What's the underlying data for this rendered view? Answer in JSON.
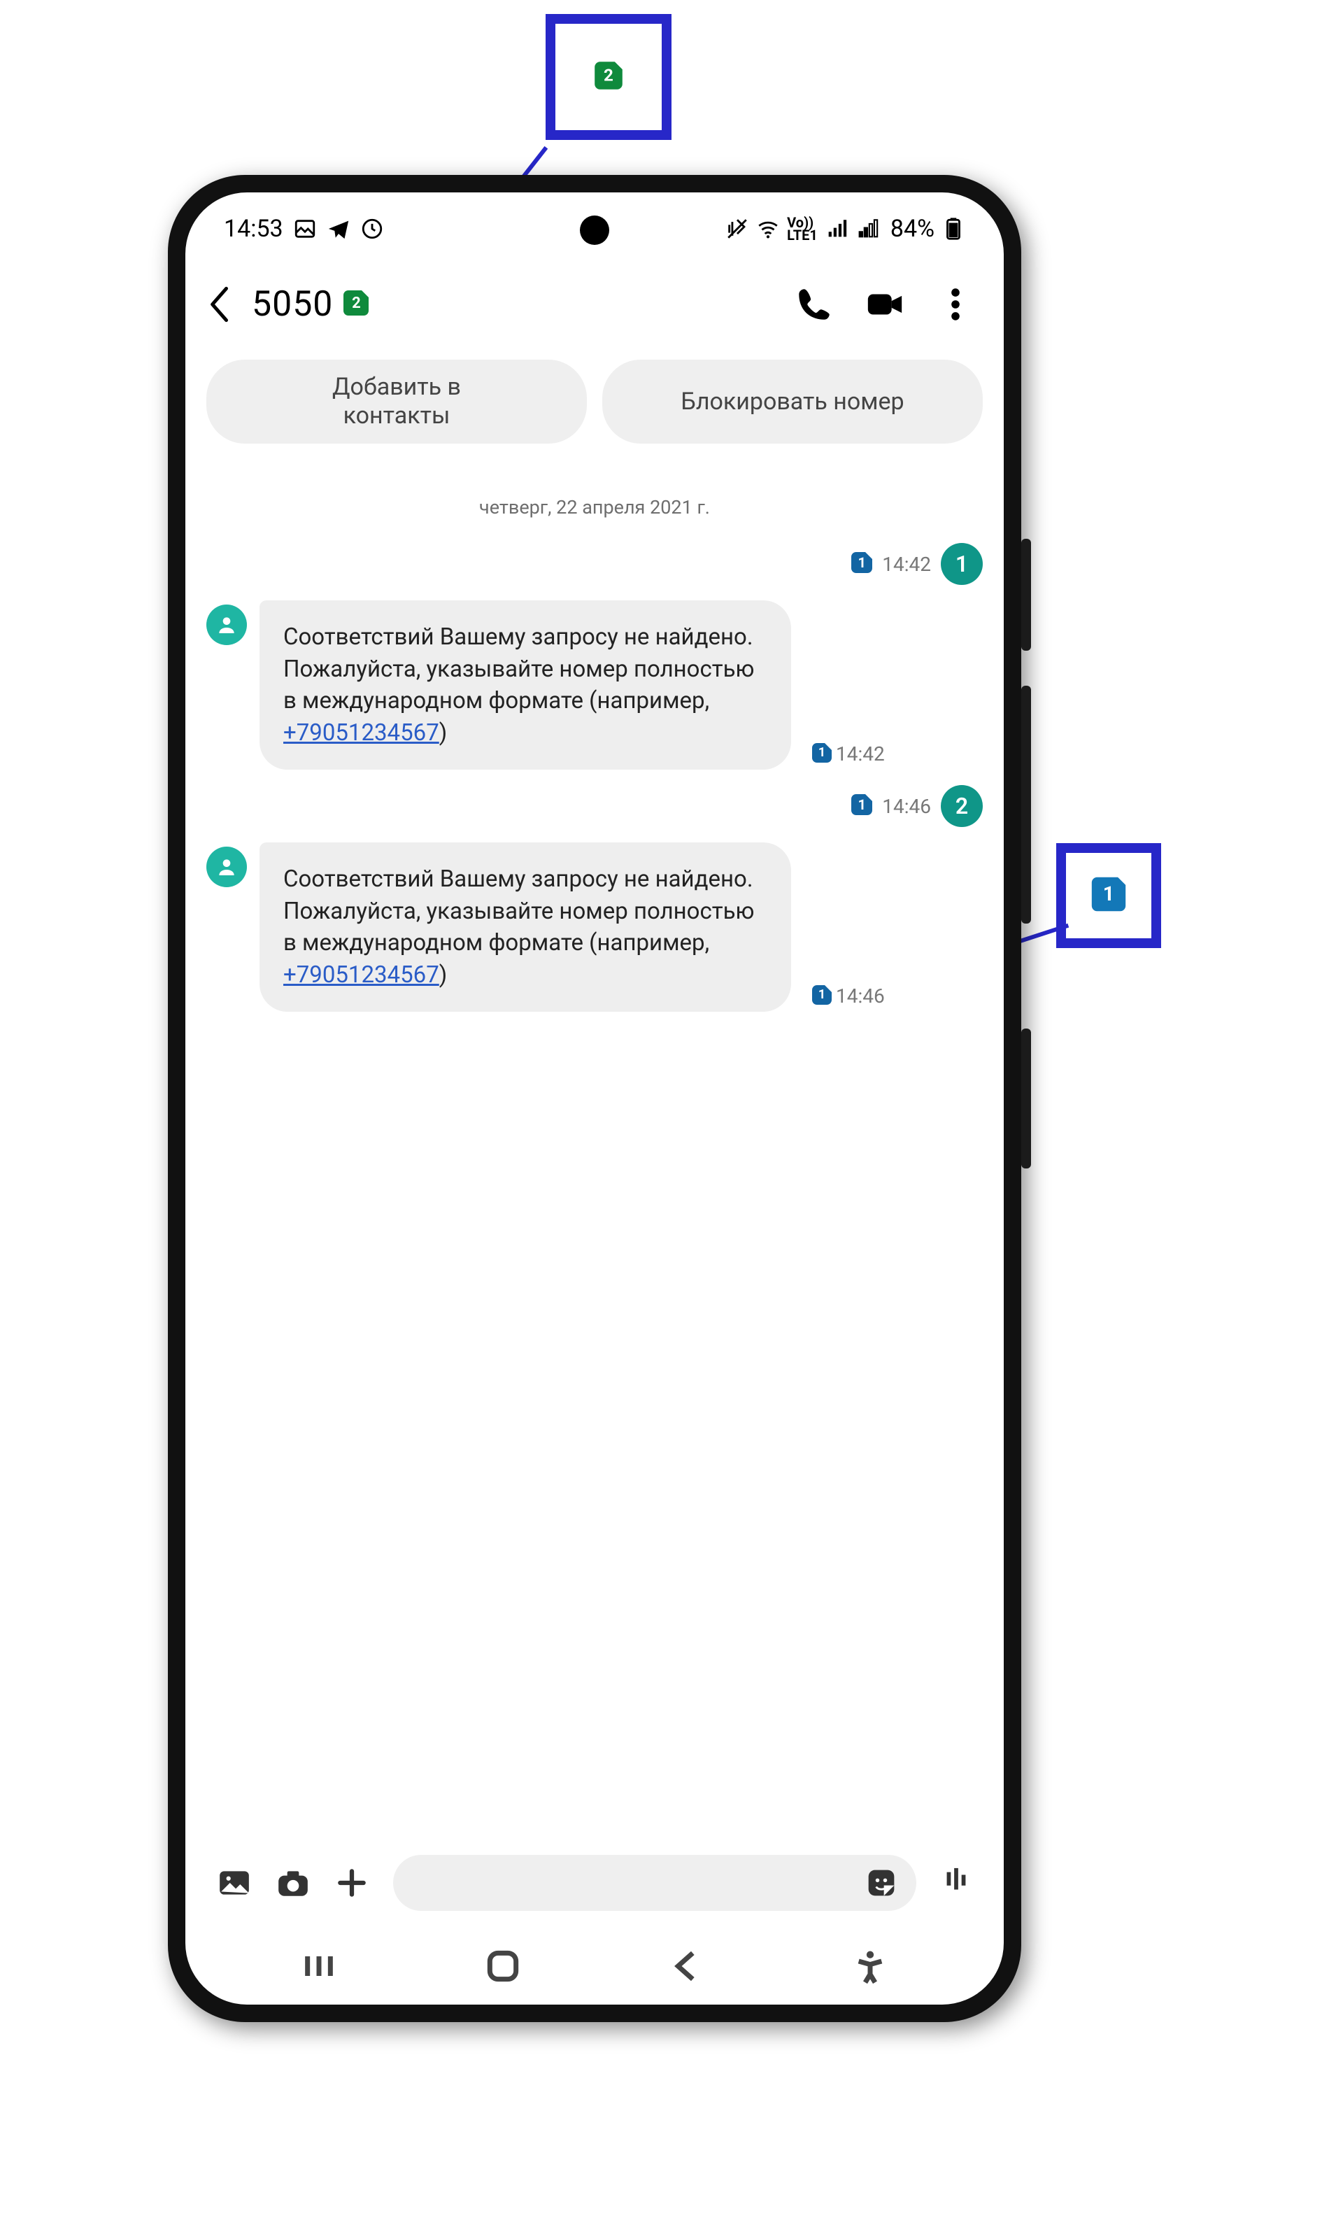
{
  "colors": {
    "accent_blue": "#2727c8",
    "teal": "#0f9688",
    "sim_green": "#0f8a3c",
    "sim_blue": "#1378b8"
  },
  "status": {
    "time": "14:53",
    "battery": "84%"
  },
  "header": {
    "contact_number": "5050",
    "sim_indicator": "2"
  },
  "chips": {
    "add_contact": "Добавить в контакты",
    "block_number": "Блокировать номер"
  },
  "date_separator": "четверг, 22 апреля 2021 г.",
  "messages": [
    {
      "dir": "out",
      "num": "1",
      "sim": "1",
      "time": "14:42"
    },
    {
      "dir": "in",
      "text_prefix": "Соответствий Вашему запросу не найдено. Пожалуйста, указывайте номер полностью в международном формате (например, ",
      "link": "+79051234567",
      "text_suffix": ")",
      "sim": "1",
      "time": "14:42"
    },
    {
      "dir": "out",
      "num": "2",
      "sim": "1",
      "time": "14:46"
    },
    {
      "dir": "in",
      "text_prefix": "Соответствий Вашему запросу не найдено. Пожалуйста, указывайте номер полностью в международном формате (например, ",
      "link": "+79051234567",
      "text_suffix": ")",
      "sim": "1",
      "time": "14:46"
    }
  ],
  "callouts": {
    "top_badge": "2",
    "side_badge": "1"
  }
}
